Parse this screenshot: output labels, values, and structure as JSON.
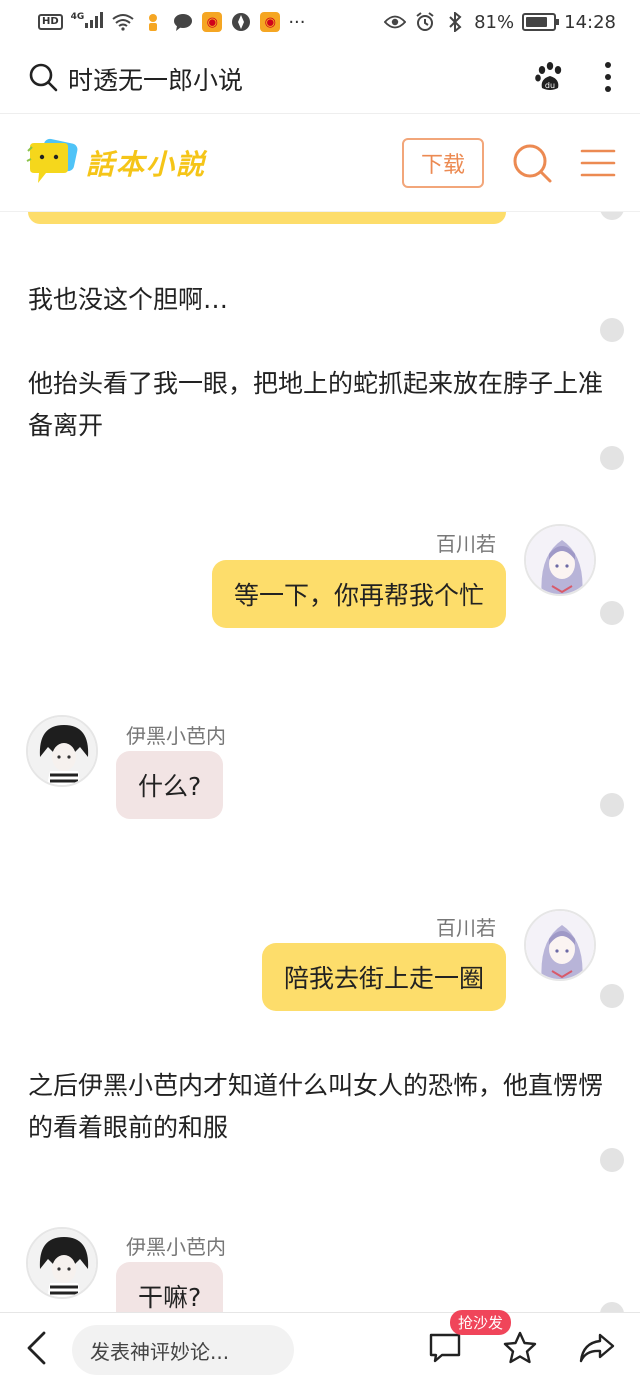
{
  "status_bar": {
    "hd": "HD",
    "network": "4G",
    "battery_text": "81%",
    "battery_level": 0.81,
    "time": "14:28",
    "more": "···"
  },
  "browser": {
    "query": "时透无一郎小说"
  },
  "site": {
    "logo_text": "話本小説",
    "download_label": "下载",
    "accent_color": "#ec8a52"
  },
  "story": {
    "paragraphs": [
      "我也没这个胆啊…",
      "他抬头看了我一眼，把地上的蛇抓起来放在脖子上准备离开",
      "之后伊黑小芭内才知道什么叫女人的恐怖，他直愣愣的看着眼前的和服"
    ],
    "messages": [
      {
        "speaker": "百川若",
        "text": "等一下，你再帮我个忙",
        "side": "right"
      },
      {
        "speaker": "伊黑小芭内",
        "text": "什么?",
        "side": "left"
      },
      {
        "speaker": "百川若",
        "text": "陪我去街上走一圈",
        "side": "right"
      },
      {
        "speaker": "伊黑小芭内",
        "text": "干嘛?",
        "side": "left"
      }
    ],
    "bubble_colors": {
      "right": "#fddd6b",
      "left": "#f2e4e4"
    }
  },
  "bottom": {
    "comment_placeholder": "发表神评妙论...",
    "sofa_badge": "抢沙发",
    "icons": [
      "back-icon",
      "comment-icon",
      "star-icon",
      "share-icon"
    ]
  }
}
